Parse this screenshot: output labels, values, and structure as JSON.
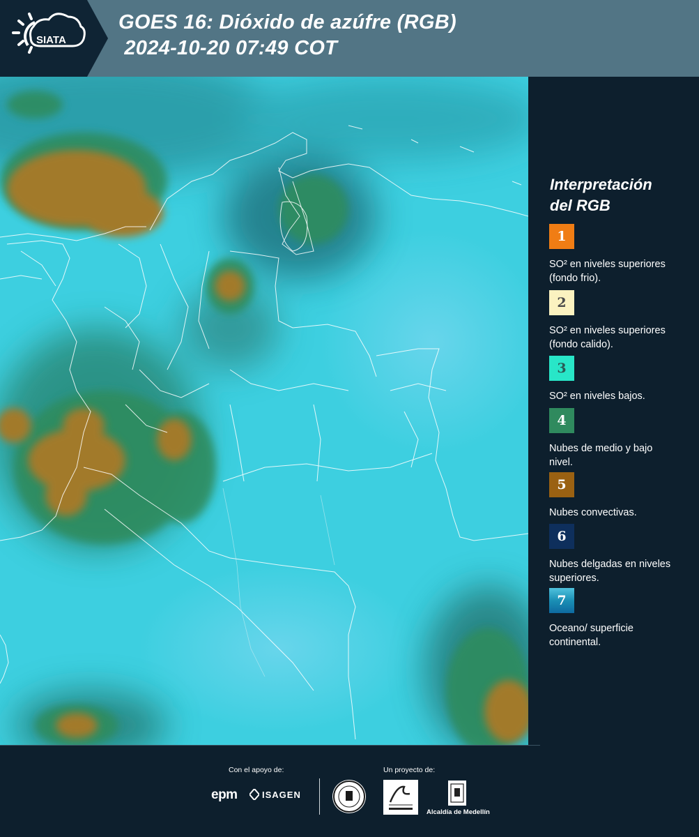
{
  "header": {
    "logo_text": "SIATA",
    "title_line1": "GOES 16: Dióxido de azúfre (RGB)",
    "title_line2": " 2024-10-20 07:49 COT"
  },
  "legend": {
    "title_line1": "Interpretación",
    "title_line2": "del RGB",
    "items": [
      {
        "number": "1",
        "label": "SO² en niveles superiores (fondo frio).",
        "color": "#f07d14",
        "text_color": "#ffffff"
      },
      {
        "number": "2",
        "label": "SO² en niveles superiores (fondo calido).",
        "color": "#fbf2c0",
        "text_color": "#4a4a4a"
      },
      {
        "number": "3",
        "label": "SO² en niveles bajos.",
        "color": "#28e6c8",
        "text_color": "#2a5a55"
      },
      {
        "number": "4",
        "label": "Nubes de medio y bajo nivel.",
        "color": "#2f8a5e",
        "text_color": "#ffffff"
      },
      {
        "number": "5",
        "label": "Nubes convectivas.",
        "color": "#9a6112",
        "text_color": "#ffffff"
      },
      {
        "number": "6",
        "label": "Nubes delgadas en niveles superiores.",
        "color": "#0e2f5c",
        "text_color": "#ffffff"
      },
      {
        "number": "7",
        "label": "Oceano/ superficie continental.",
        "color": "#1a8fb5",
        "text_color": "#ffffff"
      }
    ]
  },
  "footer": {
    "support_label": "Con el apoyo de:",
    "project_label": "Un proyecto de:",
    "sponsor_1": "epm",
    "sponsor_2": "ISAGEN",
    "partner_3": "Alcaldía de Medellín"
  },
  "colors": {
    "header_bg": "#527585",
    "page_bg": "#0d1f2d",
    "ocean_surface": "#3fd0e0",
    "convective": "#a27a2c",
    "mid_low_cloud": "#2e8a6a"
  }
}
